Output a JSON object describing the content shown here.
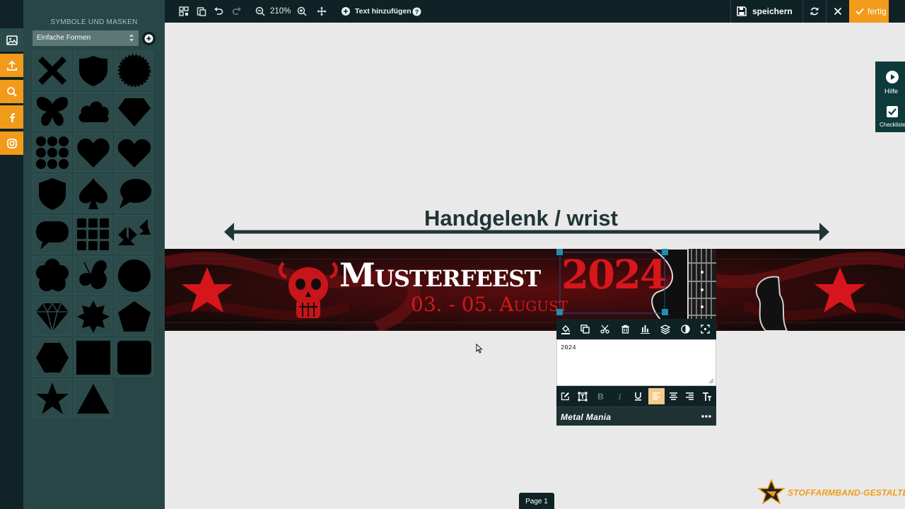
{
  "panel": {
    "title": "SYMBOLE UND MASKEN",
    "category": "Einfache Formen",
    "shapes": [
      "x",
      "shield",
      "badge-circle",
      "butterfly",
      "cloud",
      "diamond",
      "dots",
      "heart",
      "heart",
      "shield",
      "spade",
      "speech-bubble",
      "speech-bubble",
      "squares-grid",
      "triangles",
      "flower",
      "butterfly-outline",
      "circle",
      "gem",
      "star-burst",
      "pentagon",
      "hexagon",
      "square",
      "rounded-square",
      "star",
      "triangle"
    ]
  },
  "toolbar": {
    "zoom": "210%",
    "add_text": "Text hinzufügen",
    "save": "speichern",
    "done": "fertig"
  },
  "canvas": {
    "wrist_label": "Handgelenk / wrist",
    "banner": {
      "title": "Musterfeest",
      "year": "2024",
      "dates": "03. - 05. August"
    }
  },
  "help": {
    "help_label": "Hilfe",
    "checklist_label": "Checkliste"
  },
  "editor": {
    "text_value": "2024",
    "font_name": "Metal Mania"
  },
  "footer": {
    "page": "Page 1",
    "brand": "STOFFARMBAND-GESTALTEN.DE"
  },
  "colors": {
    "accent": "#f29a19",
    "dark": "#0f2326",
    "panel": "#284646",
    "banner_red": "#c8151b"
  }
}
